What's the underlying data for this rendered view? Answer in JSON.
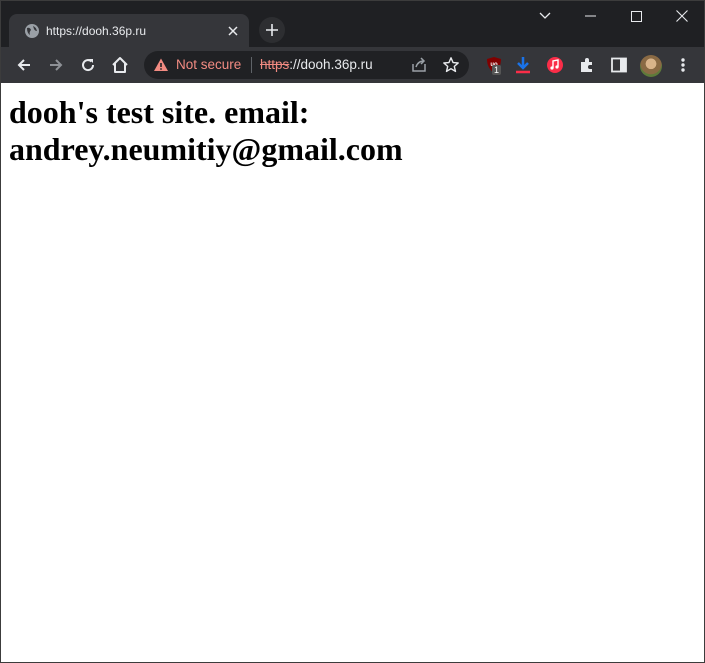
{
  "tab": {
    "title": "https://dooh.36p.ru"
  },
  "omnibox": {
    "security_label": "Not secure",
    "url_scheme": "https",
    "url_rest": "://dooh.36p.ru"
  },
  "extensions": {
    "ublock_badge": "1"
  },
  "page": {
    "heading": "dooh's test site. email: andrey.neumitiy@gmail.com"
  },
  "colors": {
    "frame": "#1f2023",
    "toolbar": "#35363a",
    "warning": "#f28b82",
    "download": "#1a73e8",
    "music": "#fa2d48"
  }
}
